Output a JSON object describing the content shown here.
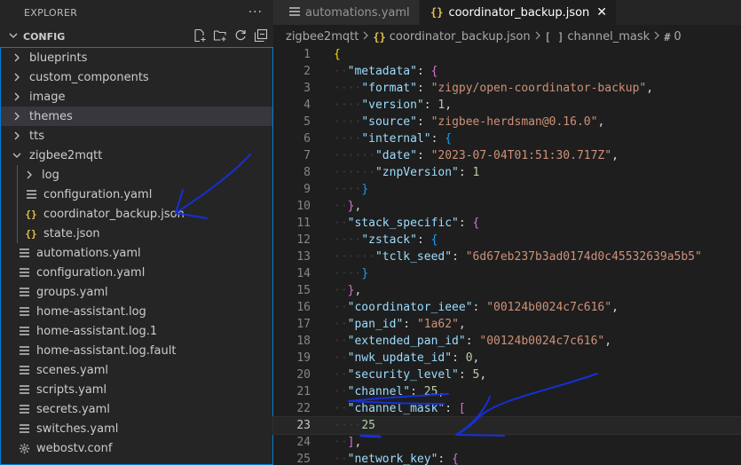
{
  "explorer": {
    "title": "EXPLORER",
    "more_label": "···",
    "section_title": "CONFIG",
    "items": [
      {
        "label": "blueprints",
        "kind": "folder",
        "depth": 0,
        "open": false,
        "icon": "chevron-right-icon"
      },
      {
        "label": "custom_components",
        "kind": "folder",
        "depth": 0,
        "open": false,
        "icon": "chevron-right-icon"
      },
      {
        "label": "image",
        "kind": "folder",
        "depth": 0,
        "open": false,
        "icon": "chevron-right-icon"
      },
      {
        "label": "themes",
        "kind": "folder",
        "depth": 0,
        "open": false,
        "icon": "chevron-right-icon"
      },
      {
        "label": "tts",
        "kind": "folder",
        "depth": 0,
        "open": false,
        "icon": "chevron-right-icon"
      },
      {
        "label": "zigbee2mqtt",
        "kind": "folder",
        "depth": 0,
        "open": true,
        "icon": "chevron-down-icon"
      },
      {
        "label": "log",
        "kind": "folder",
        "depth": 1,
        "open": false,
        "icon": "chevron-right-icon"
      },
      {
        "label": "configuration.yaml",
        "kind": "yaml",
        "depth": 1,
        "icon": "lines-file-icon"
      },
      {
        "label": "coordinator_backup.json",
        "kind": "json",
        "depth": 1,
        "icon": "json-braces-icon"
      },
      {
        "label": "state.json",
        "kind": "json",
        "depth": 1,
        "icon": "json-braces-icon"
      },
      {
        "label": "automations.yaml",
        "kind": "yaml",
        "depth": 0,
        "icon": "lines-file-icon"
      },
      {
        "label": "configuration.yaml",
        "kind": "yaml",
        "depth": 0,
        "icon": "lines-file-icon"
      },
      {
        "label": "groups.yaml",
        "kind": "yaml",
        "depth": 0,
        "icon": "lines-file-icon"
      },
      {
        "label": "home-assistant.log",
        "kind": "log",
        "depth": 0,
        "icon": "lines-file-icon"
      },
      {
        "label": "home-assistant.log.1",
        "kind": "log",
        "depth": 0,
        "icon": "lines-file-icon"
      },
      {
        "label": "home-assistant.log.fault",
        "kind": "log",
        "depth": 0,
        "icon": "lines-file-icon"
      },
      {
        "label": "scenes.yaml",
        "kind": "yaml",
        "depth": 0,
        "icon": "lines-file-icon"
      },
      {
        "label": "scripts.yaml",
        "kind": "yaml",
        "depth": 0,
        "icon": "lines-file-icon"
      },
      {
        "label": "secrets.yaml",
        "kind": "yaml",
        "depth": 0,
        "icon": "lines-file-icon"
      },
      {
        "label": "switches.yaml",
        "kind": "yaml",
        "depth": 0,
        "icon": "lines-file-icon"
      },
      {
        "label": "webostv.conf",
        "kind": "conf",
        "depth": 0,
        "icon": "gear-icon"
      }
    ]
  },
  "tabs": [
    {
      "label": "automations.yaml",
      "active": false,
      "icon": "lines-file-icon"
    },
    {
      "label": "coordinator_backup.json",
      "active": true,
      "icon": "json-braces-icon",
      "close": "✕"
    }
  ],
  "breadcrumb": {
    "folder": "zigbee2mqtt",
    "file": "coordinator_backup.json",
    "array_node": "channel_mask",
    "index_node": "0"
  },
  "editor": {
    "current_line": 23,
    "lines": [
      {
        "n": "1",
        "tokens": [
          [
            "b1",
            "{"
          ]
        ]
      },
      {
        "n": "2",
        "tokens": [
          [
            "k",
            "\"metadata\""
          ],
          [
            "p",
            ": "
          ],
          [
            "b2",
            "{"
          ]
        ]
      },
      {
        "n": "3",
        "tokens": [
          [
            "k",
            "\"format\""
          ],
          [
            "p",
            ": "
          ],
          [
            "s",
            "\"zigpy/open-coordinator-backup\""
          ],
          [
            "p",
            ","
          ]
        ]
      },
      {
        "n": "4",
        "tokens": [
          [
            "k",
            "\"version\""
          ],
          [
            "p",
            ": "
          ],
          [
            "n",
            "1"
          ],
          [
            "p",
            ","
          ]
        ]
      },
      {
        "n": "5",
        "tokens": [
          [
            "k",
            "\"source\""
          ],
          [
            "p",
            ": "
          ],
          [
            "s",
            "\"zigbee-herdsman@0.16.0\""
          ],
          [
            "p",
            ","
          ]
        ]
      },
      {
        "n": "6",
        "tokens": [
          [
            "k",
            "\"internal\""
          ],
          [
            "p",
            ": "
          ],
          [
            "b3",
            "{"
          ]
        ]
      },
      {
        "n": "7",
        "tokens": [
          [
            "k",
            "\"date\""
          ],
          [
            "p",
            ": "
          ],
          [
            "s",
            "\"2023-07-04T01:51:30.717Z\""
          ],
          [
            "p",
            ","
          ]
        ]
      },
      {
        "n": "8",
        "tokens": [
          [
            "k",
            "\"znpVersion\""
          ],
          [
            "p",
            ": "
          ],
          [
            "n",
            "1"
          ]
        ]
      },
      {
        "n": "9",
        "tokens": [
          [
            "b3",
            "}"
          ]
        ]
      },
      {
        "n": "10",
        "tokens": [
          [
            "b2",
            "}"
          ],
          [
            "p",
            ","
          ]
        ]
      },
      {
        "n": "11",
        "tokens": [
          [
            "k",
            "\"stack_specific\""
          ],
          [
            "p",
            ": "
          ],
          [
            "b2",
            "{"
          ]
        ]
      },
      {
        "n": "12",
        "tokens": [
          [
            "k",
            "\"zstack\""
          ],
          [
            "p",
            ": "
          ],
          [
            "b3",
            "{"
          ]
        ]
      },
      {
        "n": "13",
        "tokens": [
          [
            "k",
            "\"tclk_seed\""
          ],
          [
            "p",
            ": "
          ],
          [
            "s",
            "\"6d67eb237b3ad0174d0c45532639a5b5\""
          ]
        ]
      },
      {
        "n": "14",
        "tokens": [
          [
            "b3",
            "}"
          ]
        ]
      },
      {
        "n": "15",
        "tokens": [
          [
            "b2",
            "}"
          ],
          [
            "p",
            ","
          ]
        ]
      },
      {
        "n": "16",
        "tokens": [
          [
            "k",
            "\"coordinator_ieee\""
          ],
          [
            "p",
            ": "
          ],
          [
            "s",
            "\"00124b0024c7c616\""
          ],
          [
            "p",
            ","
          ]
        ]
      },
      {
        "n": "17",
        "tokens": [
          [
            "k",
            "\"pan_id\""
          ],
          [
            "p",
            ": "
          ],
          [
            "s",
            "\"1a62\""
          ],
          [
            "p",
            ","
          ]
        ]
      },
      {
        "n": "18",
        "tokens": [
          [
            "k",
            "\"extended_pan_id\""
          ],
          [
            "p",
            ": "
          ],
          [
            "s",
            "\"00124b0024c7c616\""
          ],
          [
            "p",
            ","
          ]
        ]
      },
      {
        "n": "19",
        "tokens": [
          [
            "k",
            "\"nwk_update_id\""
          ],
          [
            "p",
            ": "
          ],
          [
            "n",
            "0"
          ],
          [
            "p",
            ","
          ]
        ]
      },
      {
        "n": "20",
        "tokens": [
          [
            "k",
            "\"security_level\""
          ],
          [
            "p",
            ": "
          ],
          [
            "n",
            "5"
          ],
          [
            "p",
            ","
          ]
        ]
      },
      {
        "n": "21",
        "tokens": [
          [
            "k",
            "\"channel\""
          ],
          [
            "p",
            ": "
          ],
          [
            "n",
            "25"
          ],
          [
            "p",
            ","
          ]
        ]
      },
      {
        "n": "22",
        "tokens": [
          [
            "k",
            "\"channel_mask\""
          ],
          [
            "p",
            ": "
          ],
          [
            "b2",
            "["
          ]
        ]
      },
      {
        "n": "23",
        "tokens": [
          [
            "n",
            "25"
          ]
        ]
      },
      {
        "n": "24",
        "tokens": [
          [
            "b2",
            "]"
          ],
          [
            "p",
            ","
          ]
        ]
      },
      {
        "n": "25",
        "tokens": [
          [
            "k",
            "\"network_key\""
          ],
          [
            "p",
            ": "
          ],
          [
            "b2",
            "{"
          ]
        ]
      }
    ],
    "indents": [
      0,
      1,
      2,
      2,
      2,
      2,
      3,
      3,
      2,
      1,
      1,
      2,
      3,
      2,
      1,
      1,
      1,
      1,
      1,
      1,
      1,
      1,
      2,
      1,
      1
    ]
  },
  "colors": {
    "annotation_ink": "#1530d8",
    "focus_border": "#007fd4",
    "json_icon": "#e2c04b",
    "bracket_level1": "#ffd700",
    "bracket_level2": "#da70d6",
    "bracket_level3": "#179fff"
  }
}
